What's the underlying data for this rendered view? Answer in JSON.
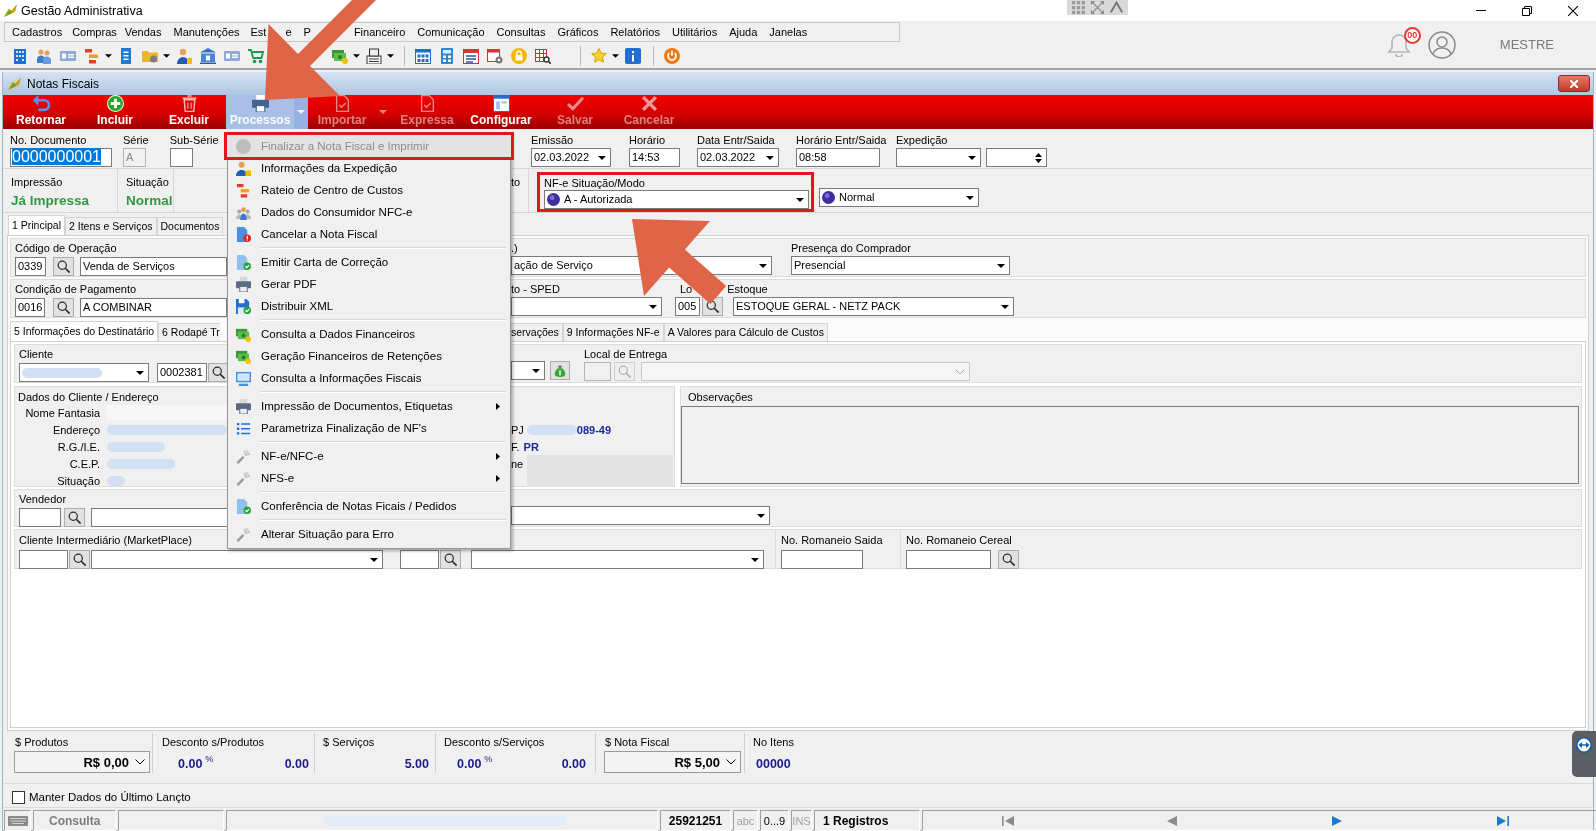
{
  "window": {
    "title": "Gestão Administrativa"
  },
  "menu_bar": [
    "Cadastros",
    "Compras",
    "Vendas",
    "Manutenções",
    "Est",
    "e",
    "P",
    "Financeiro",
    "Comunicação",
    "Consultas",
    "Gráficos",
    "Relatórios",
    "Utilitários",
    "Ajuda",
    "Janelas"
  ],
  "user": {
    "name": "MESTRE",
    "notifications": "00"
  },
  "document_window": {
    "title": "Notas Fiscais"
  },
  "action_bar": [
    {
      "label": "Retornar",
      "disabled": false,
      "pressed": false,
      "has_menu": false
    },
    {
      "label": "Incluir",
      "disabled": false,
      "pressed": false,
      "has_menu": false
    },
    {
      "label": "Excluir",
      "disabled": false,
      "pressed": false,
      "has_menu": false
    },
    {
      "label": "Processos",
      "disabled": false,
      "pressed": true,
      "has_menu": true
    },
    {
      "label": "Importar",
      "disabled": true,
      "pressed": false,
      "has_menu": true
    },
    {
      "label": "Expressa",
      "disabled": true,
      "pressed": false,
      "has_menu": false
    },
    {
      "label": "Configurar",
      "disabled": false,
      "pressed": false,
      "has_menu": false
    },
    {
      "label": "Salvar",
      "disabled": true,
      "pressed": false,
      "has_menu": false
    },
    {
      "label": "Cancelar",
      "disabled": true,
      "pressed": false,
      "has_menu": false
    }
  ],
  "header": {
    "document_number": {
      "label": "No. Documento",
      "value": "0000000001",
      "selected": true
    },
    "series": {
      "label": "Série",
      "value": "A",
      "disabled": true
    },
    "sub_series": {
      "label": "Sub-Série"
    },
    "issue_date": {
      "label": "Emissão",
      "value": "02.03.2022"
    },
    "issue_time": {
      "label": "Horário",
      "value": "14:53"
    },
    "entry_exit_date": {
      "label": "Data Entr/Saida",
      "value": "02.03.2022"
    },
    "entry_exit_time": {
      "label": "Horário Entr/Saida",
      "value": "08:58"
    },
    "dispatch": {
      "label": "Expedição"
    }
  },
  "status": {
    "printing": {
      "label": "Impressão",
      "value": "Já Impressa"
    },
    "situation": {
      "label": "Situação",
      "value": "Normal"
    },
    "cut_label": "to",
    "nfe": {
      "label": "NF-e Situação/Modo",
      "value": "A - Autorizada",
      "mode": "Normal",
      "framed": true
    }
  },
  "tabs": [
    {
      "label": "1 Principal",
      "selected": true
    },
    {
      "label": "2 Itens e Serviços",
      "selected": false
    },
    {
      "label": "Documentos",
      "selected": false
    }
  ],
  "main": {
    "operation": {
      "label": "Código de Operação",
      "code": "0339",
      "name": "Venda de Serviços"
    },
    "operation_type": {
      "label": ".)",
      "value": "ação de Serviço"
    },
    "buyer_presence": {
      "label": "Presença do Comprador",
      "value": "Presencial"
    },
    "payment": {
      "label": "Condição de Pagamento",
      "code": "0016",
      "name": "A COMBINAR"
    },
    "sped": {
      "label": "to - SPED"
    },
    "stock": {
      "label_parts": [
        "Lo",
        "Estoque"
      ],
      "code": "005",
      "name": "ESTOQUE GERAL - NETZ PACK"
    }
  },
  "sub_tabs": {
    "left": [
      {
        "label": "5 Informações do Destinatário",
        "selected": true
      },
      {
        "label": "6 Rodapé Tr",
        "selected": false
      }
    ],
    "right": [
      {
        "label": "servações",
        "selected": false
      },
      {
        "label": "9 Informações NF-e",
        "selected": false
      },
      {
        "label": "A Valores para Cálculo de Custos",
        "selected": false
      }
    ]
  },
  "recipient": {
    "client": {
      "label": "Cliente",
      "code": "0002381",
      "redacted": true
    },
    "delivery": {
      "label": "Local de Entrega",
      "disabled": true
    },
    "address": {
      "label": "Dados do Cliente / Endereço",
      "rows": [
        {
          "label": "Nome Fantasia",
          "redacted": false
        },
        {
          "label": "Endereço",
          "redacted": true
        },
        {
          "label": "R.G./I.E.",
          "redacted": true
        },
        {
          "label": "C.E.P.",
          "redacted": true
        },
        {
          "label": "Situação",
          "redacted": true
        }
      ]
    },
    "right_fragments": [
      {
        "label": "PJ",
        "value": "089-49",
        "redacted": true
      },
      {
        "label": "F.",
        "value": "PR",
        "redacted": false
      },
      {
        "label": "ne"
      }
    ],
    "notes": {
      "label": "Observações"
    },
    "seller": {
      "label": "Vendedor"
    },
    "intermediary": {
      "label": "Cliente Intermediário (MarketPlace)"
    },
    "shipping_lists": [
      {
        "label": "No. Romaneio Saida"
      },
      {
        "label": "No. Romaneio Cereal"
      }
    ]
  },
  "totals": {
    "products": {
      "label": "$ Produtos",
      "value": "R$ 0,00"
    },
    "product_discount": {
      "label": "Desconto s/Produtos",
      "percent": "0.00",
      "percent_sign": "%",
      "value": "0.00"
    },
    "services": {
      "label": "$ Serviços",
      "value": "5.00"
    },
    "service_discount": {
      "label": "Desconto s/Serviços",
      "percent": "0.00",
      "percent_sign": "%",
      "value": "0.00"
    },
    "invoice": {
      "label": "$ Nota Fiscal",
      "value": "R$ 5,00"
    },
    "items": {
      "label": "No Itens",
      "value": "00000"
    }
  },
  "keep_last_entry": {
    "label": "Manter Dados do Último Lançto",
    "checked": false
  },
  "status_bar": {
    "mode": "Consulta",
    "number": "25921251",
    "indicators": [
      {
        "label": "abc",
        "on": false
      },
      {
        "label": "0...9",
        "on": true
      },
      {
        "label": "INS",
        "on": false
      }
    ],
    "records": "1 Registros",
    "navigation": [
      {
        "disabled": true
      },
      {
        "disabled": true
      },
      {
        "disabled": false
      },
      {
        "disabled": false
      }
    ]
  },
  "popup_menu": [
    {
      "kind": "item",
      "label": "Finalizar a Nota Fiscal e Imprimir",
      "disabled": true,
      "selected": true,
      "framed": true,
      "submenu": false
    },
    {
      "kind": "item",
      "label": "Informações da Expedição",
      "disabled": false,
      "selected": false,
      "framed": false,
      "submenu": false
    },
    {
      "kind": "item",
      "label": "Rateio de Centro de Custos",
      "disabled": false,
      "selected": false,
      "framed": false,
      "submenu": false
    },
    {
      "kind": "item",
      "label": "Dados do Consumidor NFC-e",
      "disabled": false,
      "selected": false,
      "framed": false,
      "submenu": false
    },
    {
      "kind": "item",
      "label": "Cancelar a Nota Fiscal",
      "disabled": false,
      "selected": false,
      "framed": false,
      "submenu": false
    },
    {
      "kind": "separator"
    },
    {
      "kind": "item",
      "label": "Emitir Carta de Correção",
      "disabled": false,
      "selected": false,
      "framed": false,
      "submenu": false
    },
    {
      "kind": "item",
      "label": "Gerar PDF",
      "disabled": false,
      "selected": false,
      "framed": false,
      "submenu": false
    },
    {
      "kind": "item",
      "label": "Distribuir XML",
      "disabled": false,
      "selected": false,
      "framed": false,
      "submenu": false
    },
    {
      "kind": "separator"
    },
    {
      "kind": "item",
      "label": "Consulta a Dados Financeiros",
      "disabled": false,
      "selected": false,
      "framed": false,
      "submenu": false
    },
    {
      "kind": "item",
      "label": "Geração Financeiros de Retenções",
      "disabled": false,
      "selected": false,
      "framed": false,
      "submenu": false
    },
    {
      "kind": "item",
      "label": "Consulta a Informações Fiscais",
      "disabled": false,
      "selected": false,
      "framed": false,
      "submenu": false
    },
    {
      "kind": "separator"
    },
    {
      "kind": "item",
      "label": "Impressão de Documentos, Etiquetas",
      "disabled": false,
      "selected": false,
      "framed": false,
      "submenu": true
    },
    {
      "kind": "item",
      "label": "Parametriza Finalização de NF's",
      "disabled": false,
      "selected": false,
      "framed": false,
      "submenu": false
    },
    {
      "kind": "separator"
    },
    {
      "kind": "item",
      "label": "NF-e/NFC-e",
      "disabled": false,
      "selected": false,
      "framed": false,
      "submenu": true
    },
    {
      "kind": "item",
      "label": "NFS-e",
      "disabled": false,
      "selected": false,
      "framed": false,
      "submenu": true
    },
    {
      "kind": "separator"
    },
    {
      "kind": "item",
      "label": "Conferência de Notas Ficais / Pedidos",
      "disabled": false,
      "selected": false,
      "framed": false,
      "submenu": false
    },
    {
      "kind": "separator"
    },
    {
      "kind": "item",
      "label": "Alterar Situação para Erro",
      "disabled": false,
      "selected": false,
      "framed": false,
      "submenu": false
    }
  ]
}
